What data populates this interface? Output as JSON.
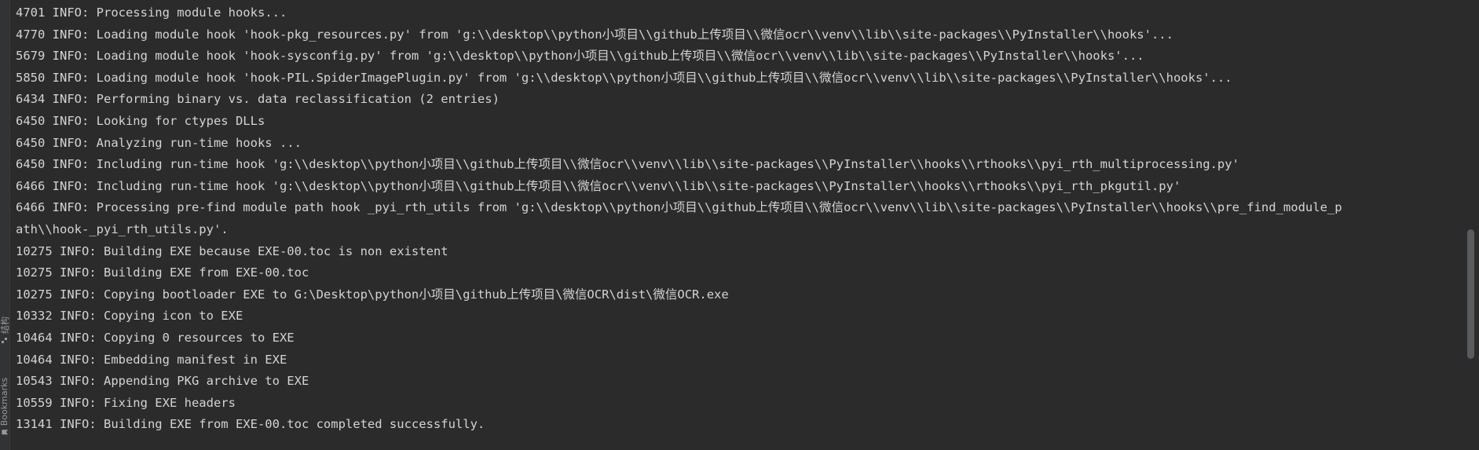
{
  "side_panel": {
    "structure_label": "结构",
    "bookmarks_label": "Bookmarks"
  },
  "console": {
    "lines": [
      "4701 INFO: Processing module hooks...",
      "4770 INFO: Loading module hook 'hook-pkg_resources.py' from 'g:\\\\desktop\\\\python小项目\\\\github上传项目\\\\微信ocr\\\\venv\\\\lib\\\\site-packages\\\\PyInstaller\\\\hooks'...",
      "5679 INFO: Loading module hook 'hook-sysconfig.py' from 'g:\\\\desktop\\\\python小项目\\\\github上传项目\\\\微信ocr\\\\venv\\\\lib\\\\site-packages\\\\PyInstaller\\\\hooks'...",
      "5850 INFO: Loading module hook 'hook-PIL.SpiderImagePlugin.py' from 'g:\\\\desktop\\\\python小项目\\\\github上传项目\\\\微信ocr\\\\venv\\\\lib\\\\site-packages\\\\PyInstaller\\\\hooks'...",
      "6434 INFO: Performing binary vs. data reclassification (2 entries)",
      "6450 INFO: Looking for ctypes DLLs",
      "6450 INFO: Analyzing run-time hooks ...",
      "6450 INFO: Including run-time hook 'g:\\\\desktop\\\\python小项目\\\\github上传项目\\\\微信ocr\\\\venv\\\\lib\\\\site-packages\\\\PyInstaller\\\\hooks\\\\rthooks\\\\pyi_rth_multiprocessing.py'",
      "6466 INFO: Including run-time hook 'g:\\\\desktop\\\\python小项目\\\\github上传项目\\\\微信ocr\\\\venv\\\\lib\\\\site-packages\\\\PyInstaller\\\\hooks\\\\rthooks\\\\pyi_rth_pkgutil.py'",
      "6466 INFO: Processing pre-find module path hook _pyi_rth_utils from 'g:\\\\desktop\\\\python小项目\\\\github上传项目\\\\微信ocr\\\\venv\\\\lib\\\\site-packages\\\\PyInstaller\\\\hooks\\\\pre_find_module_p",
      "ath\\\\hook-_pyi_rth_utils.py'.",
      "10275 INFO: Building EXE because EXE-00.toc is non existent",
      "10275 INFO: Building EXE from EXE-00.toc",
      "10275 INFO: Copying bootloader EXE to G:\\Desktop\\python小项目\\github上传项目\\微信OCR\\dist\\微信OCR.exe",
      "10332 INFO: Copying icon to EXE",
      "10464 INFO: Copying 0 resources to EXE",
      "10464 INFO: Embedding manifest in EXE",
      "10543 INFO: Appending PKG archive to EXE",
      "10559 INFO: Fixing EXE headers",
      "13141 INFO: Building EXE from EXE-00.toc completed successfully."
    ]
  },
  "colors": {
    "background": "#2b2b2b",
    "text": "#d4d4d4",
    "side_strip": "#313335",
    "scrollbar_thumb": "#595b5d"
  }
}
